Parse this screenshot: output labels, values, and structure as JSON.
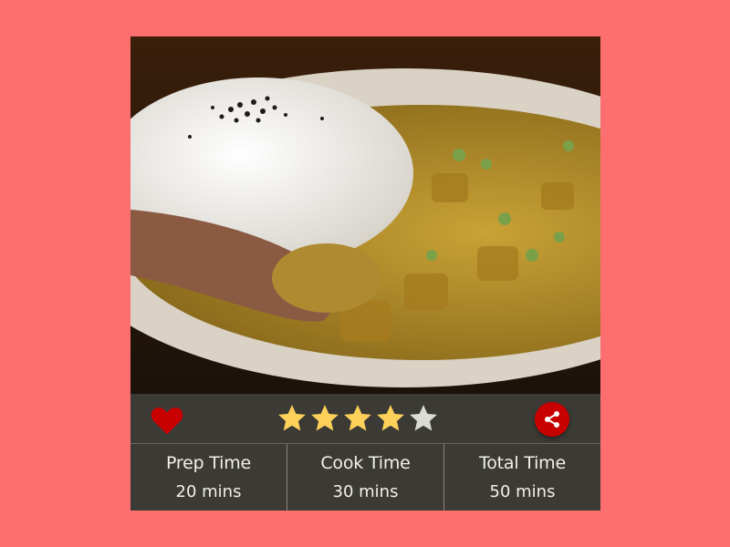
{
  "recipe": {
    "photo_alt": "Curry with rice on a plate",
    "favorite": true,
    "rating": 4,
    "rating_max": 5,
    "colors": {
      "background": "#fd6f6f",
      "card": "#3b3a35",
      "heart": "#c80000",
      "star_filled": "#fdd05a",
      "star_empty": "#dcdcd6",
      "share_button": "#c80000"
    },
    "icons": {
      "favorite": "heart-icon",
      "rating": "star-icon",
      "share": "share-icon"
    },
    "times": [
      {
        "label": "Prep Time",
        "value": "20 mins"
      },
      {
        "label": "Cook Time",
        "value": "30 mins"
      },
      {
        "label": "Total Time",
        "value": "50 mins"
      }
    ]
  }
}
